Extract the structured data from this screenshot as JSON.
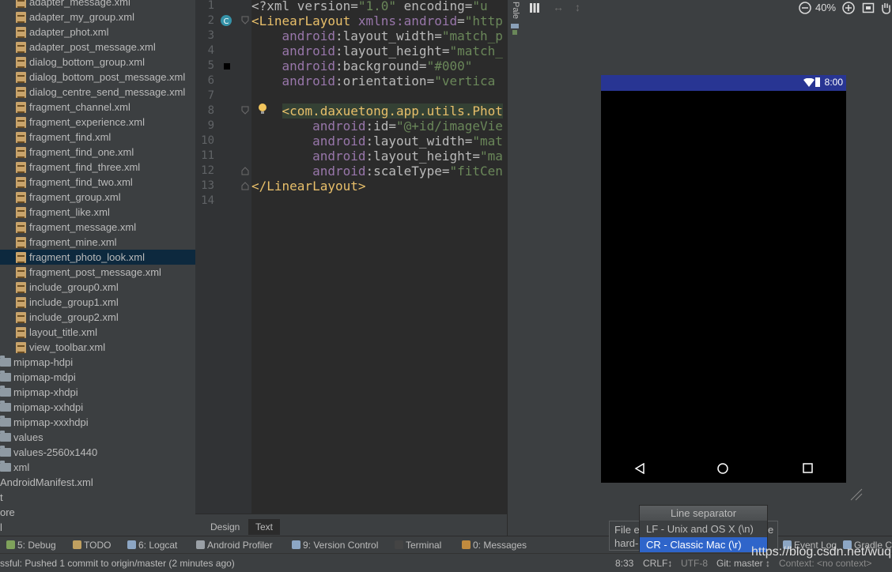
{
  "tree": {
    "xml_files": [
      "adapter_message.xml",
      "adapter_my_group.xml",
      "adapter_phot.xml",
      "adapter_post_message.xml",
      "dialog_bottom_group.xml",
      "dialog_bottom_post_message.xml",
      "dialog_centre_send_message.xml",
      "fragment_channel.xml",
      "fragment_experience.xml",
      "fragment_find.xml",
      "fragment_find_one.xml",
      "fragment_find_three.xml",
      "fragment_find_two.xml",
      "fragment_group.xml",
      "fragment_like.xml",
      "fragment_message.xml",
      "fragment_mine.xml",
      "fragment_photo_look.xml",
      "fragment_post_message.xml",
      "include_group0.xml",
      "include_group1.xml",
      "include_group2.xml",
      "layout_title.xml",
      "view_toolbar.xml"
    ],
    "selected_index": 17,
    "folders": [
      "mipmap-hdpi",
      "mipmap-mdpi",
      "mipmap-xhdpi",
      "mipmap-xxhdpi",
      "mipmap-xxxhdpi",
      "values",
      "values-2560x1440",
      "xml"
    ],
    "manifest": "AndroidManifest.xml",
    "partial_rows": [
      "t",
      "ore",
      "l"
    ]
  },
  "editor": {
    "line_numbers": [
      "1",
      "2",
      "3",
      "4",
      "5",
      "6",
      "7",
      "8",
      "9",
      "10",
      "11",
      "12",
      "13",
      "14"
    ],
    "lines": [
      {
        "indent": "",
        "parts": [
          {
            "c": "t-attr",
            "t": "<?xml version="
          },
          {
            "c": "t-val",
            "t": "\"1.0\""
          },
          {
            "c": "t-attr",
            "t": " encoding="
          },
          {
            "c": "t-val",
            "t": "\"u"
          }
        ]
      },
      {
        "indent": "",
        "parts": [
          {
            "c": "t-br",
            "t": "<"
          },
          {
            "c": "t-tag",
            "t": "LinearLayout"
          },
          {
            "c": "t-attr",
            "t": " "
          },
          {
            "c": "t-ns",
            "t": "xmlns:android"
          },
          {
            "c": "t-attr",
            "t": "="
          },
          {
            "c": "t-val",
            "t": "\"http"
          }
        ]
      },
      {
        "indent": "    ",
        "parts": [
          {
            "c": "t-ns",
            "t": "android"
          },
          {
            "c": "t-attr",
            "t": ":layout_width="
          },
          {
            "c": "t-val",
            "t": "\"match_p"
          }
        ]
      },
      {
        "indent": "    ",
        "parts": [
          {
            "c": "t-ns",
            "t": "android"
          },
          {
            "c": "t-attr",
            "t": ":layout_height="
          },
          {
            "c": "t-val",
            "t": "\"match_"
          }
        ]
      },
      {
        "indent": "    ",
        "parts": [
          {
            "c": "t-ns",
            "t": "android"
          },
          {
            "c": "t-attr",
            "t": ":background="
          },
          {
            "c": "t-val",
            "t": "\"#000\""
          }
        ]
      },
      {
        "indent": "    ",
        "parts": [
          {
            "c": "t-ns",
            "t": "android"
          },
          {
            "c": "t-attr",
            "t": ":orientation="
          },
          {
            "c": "t-val",
            "t": "\"vertica"
          }
        ]
      },
      {
        "indent": "",
        "parts": []
      },
      {
        "indent": "    ",
        "hl": true,
        "parts": [
          {
            "c": "t-br",
            "t": "<"
          },
          {
            "c": "t-tag",
            "t": "com.daxuetong.app.utils.Phot"
          }
        ]
      },
      {
        "indent": "        ",
        "parts": [
          {
            "c": "t-ns",
            "t": "android"
          },
          {
            "c": "t-attr",
            "t": ":id="
          },
          {
            "c": "t-val",
            "t": "\"@+id/imageVie"
          }
        ]
      },
      {
        "indent": "        ",
        "parts": [
          {
            "c": "t-ns",
            "t": "android"
          },
          {
            "c": "t-attr",
            "t": ":layout_width="
          },
          {
            "c": "t-val",
            "t": "\"mat"
          }
        ]
      },
      {
        "indent": "        ",
        "parts": [
          {
            "c": "t-ns",
            "t": "android"
          },
          {
            "c": "t-attr",
            "t": ":layout_height="
          },
          {
            "c": "t-val",
            "t": "\"ma"
          }
        ]
      },
      {
        "indent": "        ",
        "parts": [
          {
            "c": "t-ns",
            "t": "android"
          },
          {
            "c": "t-attr",
            "t": ":scaleType="
          },
          {
            "c": "t-val",
            "t": "\"fitCen"
          }
        ]
      },
      {
        "indent": "",
        "parts": [
          {
            "c": "t-br",
            "t": "</"
          },
          {
            "c": "t-tag",
            "t": "LinearLayout"
          },
          {
            "c": "t-br",
            "t": ">"
          }
        ]
      },
      {
        "indent": "",
        "parts": []
      }
    ],
    "tabs": {
      "design": "Design",
      "text": "Text"
    }
  },
  "side_tab": "Pale",
  "preview": {
    "zoom": "40%",
    "clock": "8:00"
  },
  "tool_windows": [
    {
      "label": "5: Debug",
      "color": "#7fa25b"
    },
    {
      "label": "TODO",
      "color": "#c0a060"
    },
    {
      "label": "6: Logcat",
      "color": "#8ca6c4"
    },
    {
      "label": "Android Profiler",
      "color": "#9aa0a6"
    },
    {
      "label": "9: Version Control",
      "color": "#8ca6c4"
    },
    {
      "label": "Terminal",
      "color": "#444444"
    },
    {
      "label": "0: Messages",
      "color": "#c08a3e"
    },
    {
      "label": "Event Log",
      "color": "#8ca6c4"
    },
    {
      "label": "Gradle C",
      "color": "#8ca6c4"
    }
  ],
  "status": {
    "message": "ssful: Pushed 1 commit to origin/master (2 minutes ago)",
    "position": "8:33",
    "line_sep": "CRLF↕",
    "encoding": "UTF-8",
    "git": "Git: master ↕",
    "context": "Context: <no context>"
  },
  "tooltip": {
    "line1": "File en",
    "line1_tail": "e",
    "line2": "hard-"
  },
  "line_separator_menu": {
    "title": "Line separator",
    "options": [
      "LF - Unix and OS X (\\n)",
      "CR - Classic Mac (\\r)"
    ],
    "selected": 1
  },
  "watermark": "https://blog.csdn.net/wuqi"
}
